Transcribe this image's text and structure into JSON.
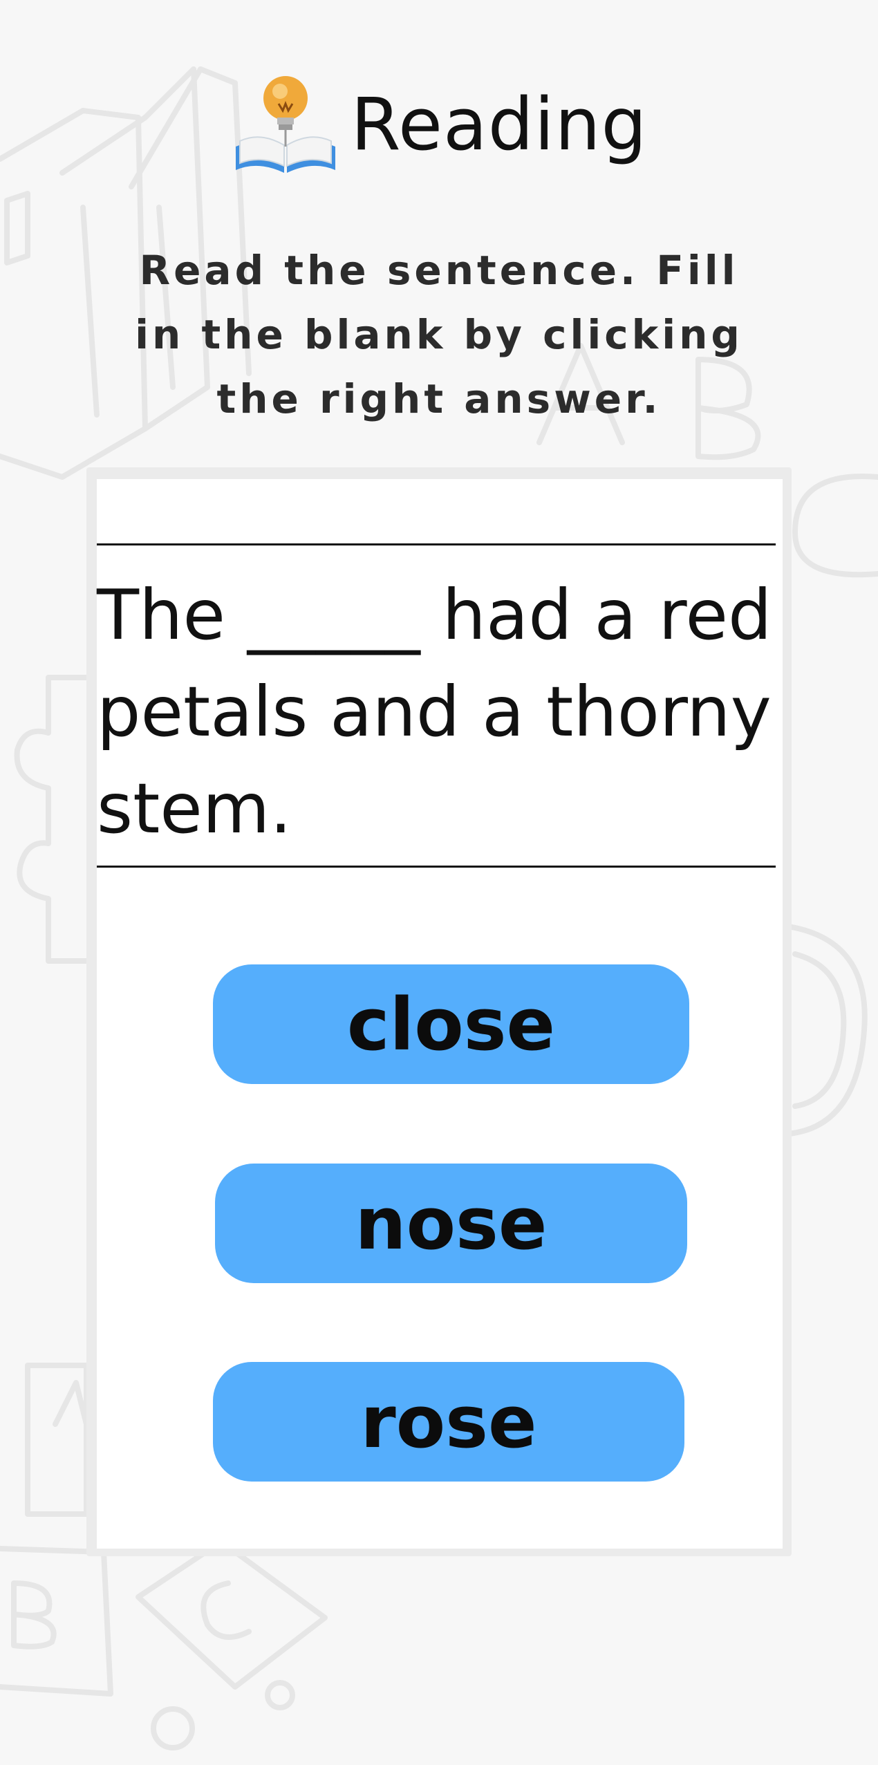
{
  "header": {
    "title": "Reading",
    "icon": "book-lightbulb-icon"
  },
  "instructions": "Read the sentence. Fill in the blank by clicking the right answer.",
  "question": {
    "sentence": "The _____ had a red petals and a thorny stem."
  },
  "answers": [
    {
      "label": "close"
    },
    {
      "label": "nose"
    },
    {
      "label": "rose"
    }
  ],
  "colors": {
    "background": "#f7f7f7",
    "card": "#ffffff",
    "button": "#55aefc",
    "text": "#111111"
  }
}
